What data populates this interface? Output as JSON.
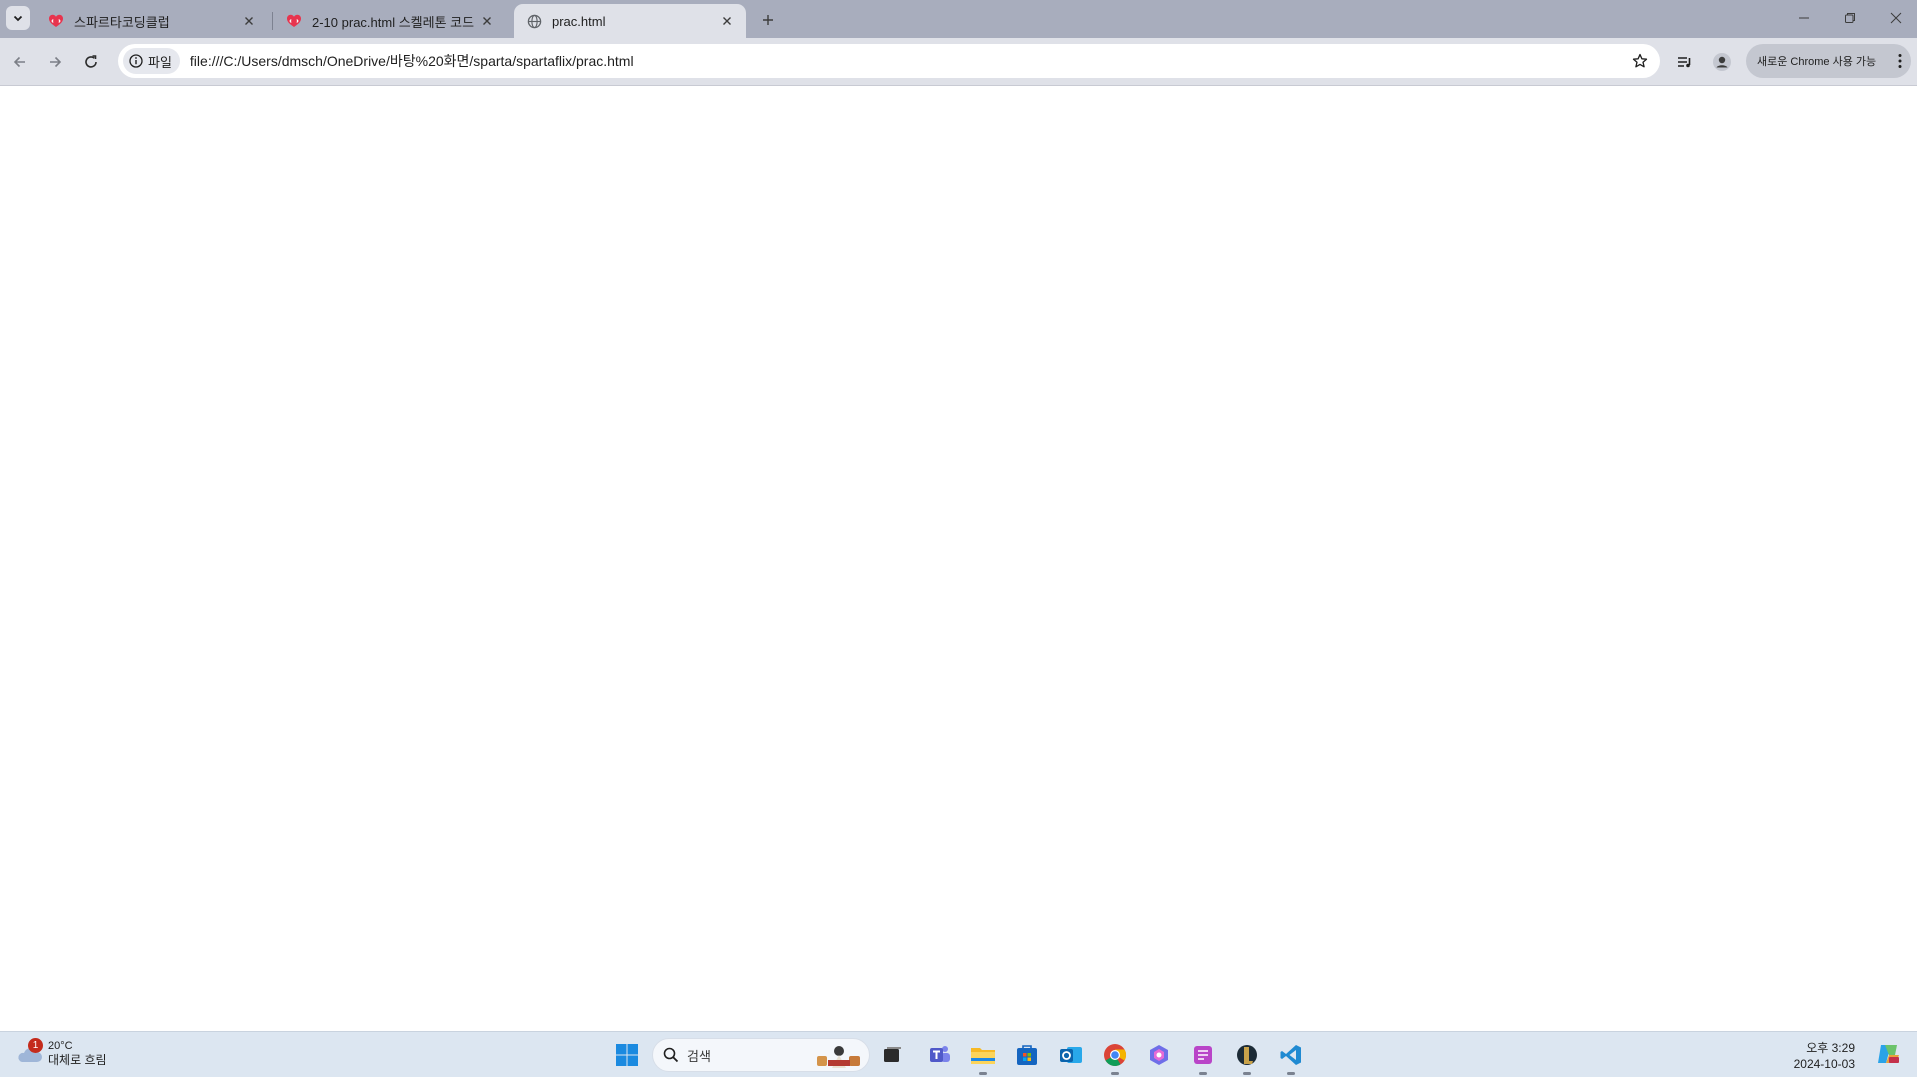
{
  "browser": {
    "tabs": [
      {
        "title": "스파르타코딩클럽",
        "favicon": "sparta-heart-icon",
        "active": false
      },
      {
        "title": "2-10 prac.html 스켈레톤 코드",
        "favicon": "sparta-heart-icon",
        "active": false
      },
      {
        "title": "prac.html",
        "favicon": "globe-icon",
        "active": true
      }
    ],
    "omnibox": {
      "chip_label": "파일",
      "url": "file:///C:/Users/dmsch/OneDrive/바탕%20화면/sparta/spartaflix/prac.html"
    },
    "update_button_label": "새로운 Chrome 사용 가능"
  },
  "taskbar": {
    "weather": {
      "badge": "1",
      "temperature": "20°C",
      "condition": "대체로 흐림"
    },
    "search_placeholder": "검색",
    "clock": {
      "time": "오후 3:29",
      "date": "2024-10-03"
    },
    "apps": [
      "start-icon",
      "task-view-icon",
      "teams-icon",
      "file-explorer-icon",
      "store-icon",
      "outlook-icon",
      "chrome-icon",
      "copilot-app-icon",
      "notes-app-icon",
      "league-app-icon",
      "vscode-icon"
    ]
  },
  "colors": {
    "tabstrip": "#a8adbd",
    "toolbar": "#dfe1e8",
    "taskbar": "#dce6f1"
  }
}
